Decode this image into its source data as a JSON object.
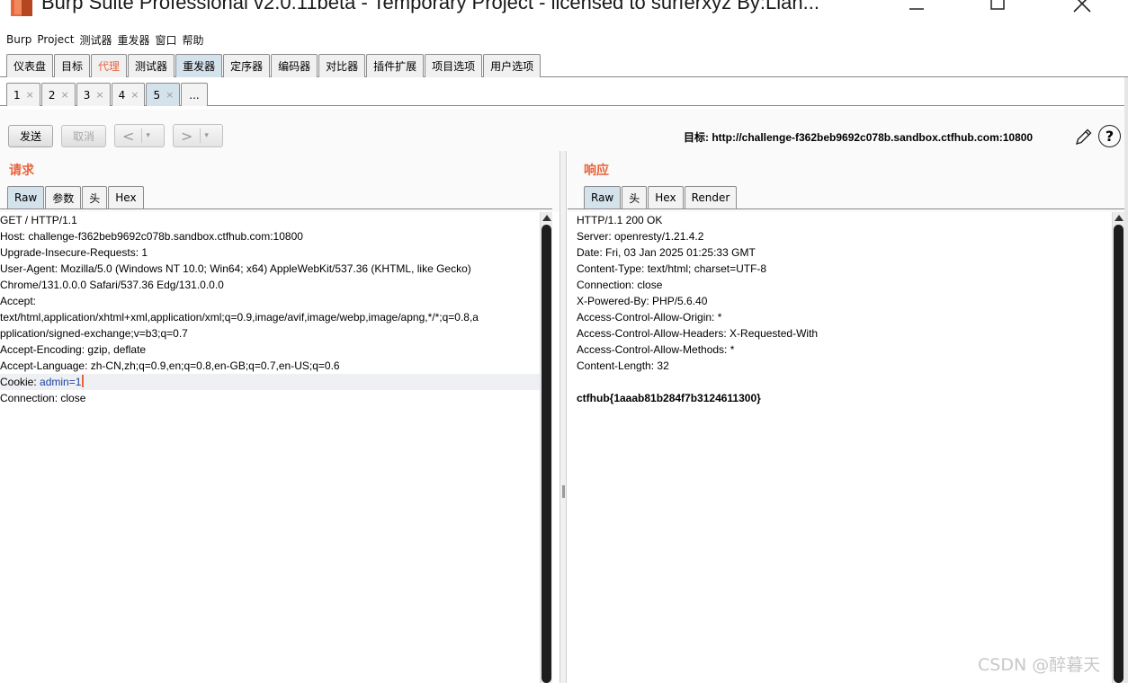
{
  "window": {
    "title": "Burp Suite Professional v2.0.11beta - Temporary Project - licensed to surferxyz By:Lian...",
    "controls": [
      "minimize-icon",
      "maximize-icon",
      "close-icon"
    ]
  },
  "menu": [
    "Burp",
    "Project",
    "测试器",
    "重发器",
    "窗口",
    "帮助"
  ],
  "main_tabs": [
    {
      "label": "仪表盘"
    },
    {
      "label": "目标"
    },
    {
      "label": "代理"
    },
    {
      "label": "测试器"
    },
    {
      "label": "重发器"
    },
    {
      "label": "定序器"
    },
    {
      "label": "编码器"
    },
    {
      "label": "对比器"
    },
    {
      "label": "插件扩展"
    },
    {
      "label": "项目选项"
    },
    {
      "label": "用户选项"
    }
  ],
  "repeater_tabs": [
    {
      "label": "1",
      "close": "×"
    },
    {
      "label": "2",
      "close": "×"
    },
    {
      "label": "3",
      "close": "×"
    },
    {
      "label": "4",
      "close": "×"
    },
    {
      "label": "5",
      "close": "×"
    },
    {
      "label": "..."
    }
  ],
  "toolbar": {
    "send_label": "发送",
    "cancel_label": "取消",
    "back_label": "<",
    "forward_label": ">",
    "dropdown_glyph": "▾",
    "target_label": "目标: http://challenge-f362beb9692c078b.sandbox.ctfhub.com:10800",
    "help_label": "?"
  },
  "request": {
    "title": "请求",
    "tabs": [
      "Raw",
      "参数",
      "头",
      "Hex"
    ],
    "lines": [
      "GET / HTTP/1.1",
      "Host: challenge-f362beb9692c078b.sandbox.ctfhub.com:10800",
      "Upgrade-Insecure-Requests: 1",
      "User-Agent: Mozilla/5.0 (Windows NT 10.0; Win64; x64) AppleWebKit/537.36 (KHTML, like Gecko)",
      "Chrome/131.0.0.0 Safari/537.36 Edg/131.0.0.0",
      "Accept:",
      "text/html,application/xhtml+xml,application/xml;q=0.9,image/avif,image/webp,image/apng,*/*;q=0.8,a",
      "pplication/signed-exchange;v=b3;q=0.7",
      "Accept-Encoding: gzip, deflate",
      "Accept-Language: zh-CN,zh;q=0.9,en;q=0.8,en-GB;q=0.7,en-US;q=0.6"
    ],
    "cookie_prefix": "Cookie: ",
    "cookie_name": "admin",
    "cookie_value": "=1",
    "last_line": "Connection: close"
  },
  "response": {
    "title": "响应",
    "tabs": [
      "Raw",
      "头",
      "Hex",
      "Render"
    ],
    "lines": [
      "HTTP/1.1 200 OK",
      "Server: openresty/1.21.4.2",
      "Date: Fri, 03 Jan 2025 01:25:33 GMT",
      "Content-Type: text/html; charset=UTF-8",
      "Connection: close",
      "X-Powered-By: PHP/5.6.40",
      "Access-Control-Allow-Origin: *",
      "Access-Control-Allow-Headers: X-Requested-With",
      "Access-Control-Allow-Methods: *",
      "Content-Length: 32"
    ],
    "body": "ctfhub{1aaab81b284f7b3124611300}"
  },
  "watermark": "CSDN @醉暮天",
  "colors": {
    "accent": "#e8643c",
    "active_tab": "#d4e2ec",
    "keyword": "#1a3fa0"
  }
}
